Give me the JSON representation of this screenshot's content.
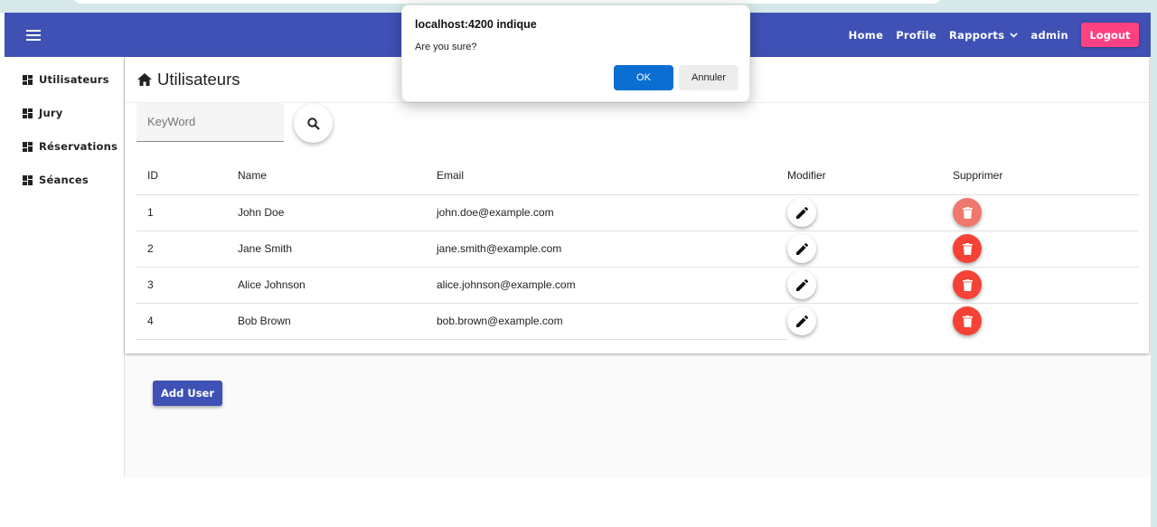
{
  "toolbar": {
    "nav": {
      "home": "Home",
      "profile": "Profile",
      "rapports": "Rapports",
      "user": "admin",
      "logout": "Logout"
    },
    "color": "#3f51b5",
    "accent": "#ff4081"
  },
  "sidebar": {
    "items": [
      {
        "label": "Utilisateurs",
        "icon": "dashboard-icon"
      },
      {
        "label": "Jury",
        "icon": "dashboard-icon"
      },
      {
        "label": "Réservations",
        "icon": "dashboard-icon"
      },
      {
        "label": "Séances",
        "icon": "dashboard-icon"
      }
    ]
  },
  "main": {
    "title": "Utilisateurs",
    "title_icon": "home-icon",
    "search": {
      "placeholder": "KeyWord",
      "value": ""
    },
    "table": {
      "headers": [
        "ID",
        "Name",
        "Email",
        "Modifier",
        "Supprimer"
      ],
      "rows": [
        {
          "id": "1",
          "name": "John Doe",
          "email": "john.doe@example.com"
        },
        {
          "id": "2",
          "name": "Jane Smith",
          "email": "jane.smith@example.com"
        },
        {
          "id": "3",
          "name": "Alice Johnson",
          "email": "alice.johnson@example.com"
        },
        {
          "id": "4",
          "name": "Bob Brown",
          "email": "bob.brown@example.com"
        }
      ]
    },
    "add_button": "Add User"
  },
  "dialog": {
    "title": "localhost:4200 indique",
    "message": "Are you sure?",
    "ok": "OK",
    "cancel": "Annuler"
  }
}
